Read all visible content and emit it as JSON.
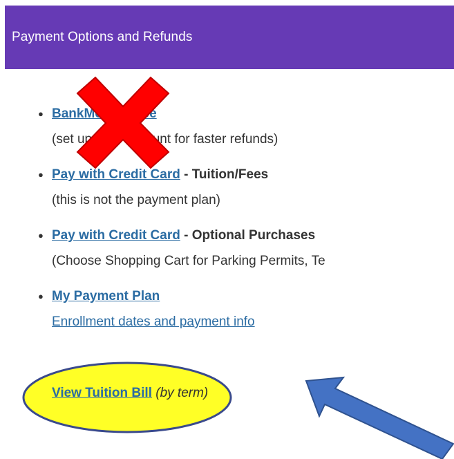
{
  "header": {
    "title": "Payment Options and Refunds"
  },
  "items": [
    {
      "link": "BankMobile Vibe",
      "line2": "(set up your account for faster refunds)"
    },
    {
      "link": "Pay with Credit Card",
      "suffix": " - Tuition/Fees",
      "line2": "(this is not the payment plan)"
    },
    {
      "link": "Pay with Credit Card",
      "suffix": " - Optional Purchases",
      "line2": "(Choose Shopping Cart for Parking Permits, Te"
    },
    {
      "link": "My Payment Plan",
      "line2": "Enrollment dates and payment info"
    }
  ],
  "tuition_bill": {
    "link": "View Tuition Bill",
    "note": " (by term)"
  },
  "annotations": {
    "cross_color": "#ff0000",
    "circle_fill": "#ffff00",
    "arrow_fill": "#4472c4",
    "header_color": "#663ab5",
    "link_color": "#2b6ca3"
  }
}
